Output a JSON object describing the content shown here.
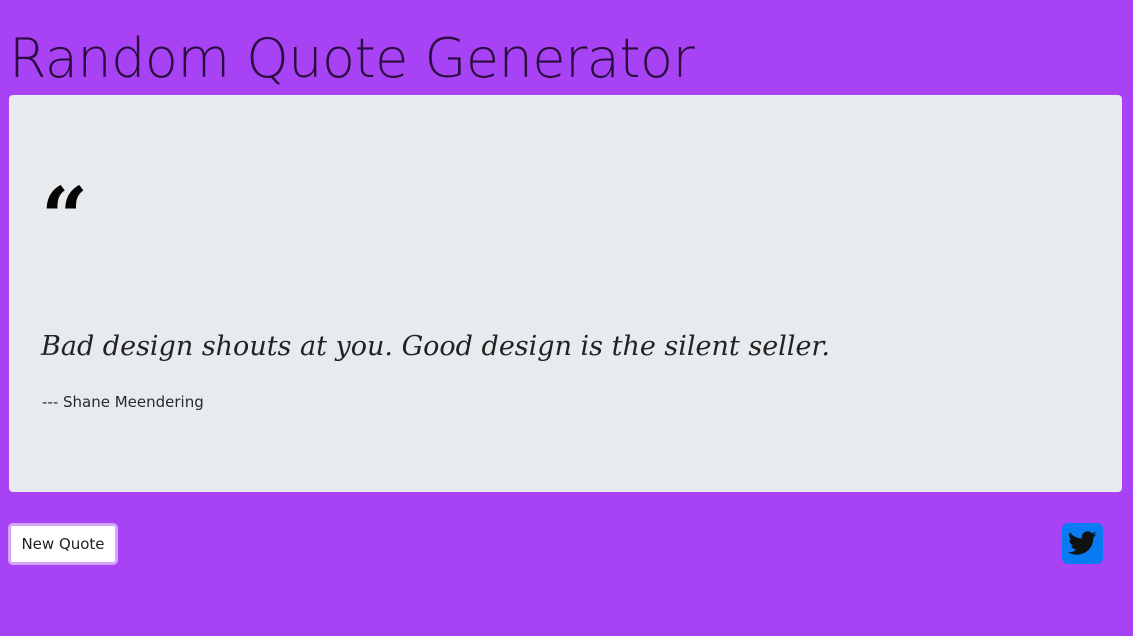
{
  "app": {
    "title": "Random Quote Generator"
  },
  "quote": {
    "mark": "“",
    "text": "Bad design shouts at you. Good design is the silent seller.",
    "author": "--- Shane Meendering"
  },
  "actions": {
    "new_quote_label": "New Quote",
    "share_icon": "twitter-icon"
  },
  "colors": {
    "background": "#a743f5",
    "card": "#e8ebee",
    "twitter": "#0a7cf3",
    "button_border": "#d6a6fb"
  }
}
